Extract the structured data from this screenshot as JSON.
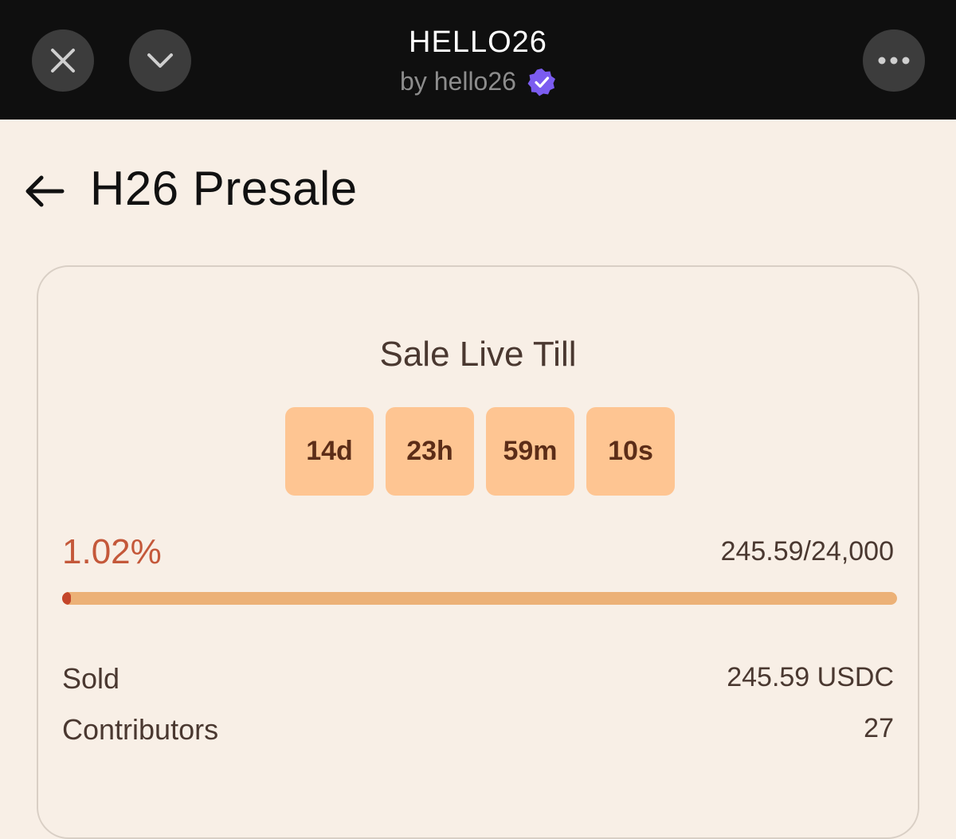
{
  "header": {
    "title": "HELLO26",
    "subtitle": "by hello26",
    "close_icon": "close-icon",
    "collapse_icon": "chevron-down-icon",
    "more_icon": "more-horizontal-icon",
    "verified_icon": "verified-badge-icon",
    "verified_color": "#7b5cf0"
  },
  "page": {
    "title": "H26 Presale",
    "back_icon": "arrow-left-icon"
  },
  "sale": {
    "heading": "Sale Live Till",
    "countdown": {
      "days": "14d",
      "hours": "23h",
      "minutes": "59m",
      "seconds": "10s"
    },
    "percent_label": "1.02%",
    "progress_fraction": 0.0102,
    "progress_text": "245.59/24,000",
    "stats": {
      "sold_label": "Sold",
      "sold_value": "245.59 USDC",
      "contributors_label": "Contributors",
      "contributors_value": "27"
    }
  },
  "colors": {
    "accent": "#c4583a",
    "countdown_bg": "#fec592",
    "progress_track": "#ecb177",
    "background": "#f8efe6"
  }
}
